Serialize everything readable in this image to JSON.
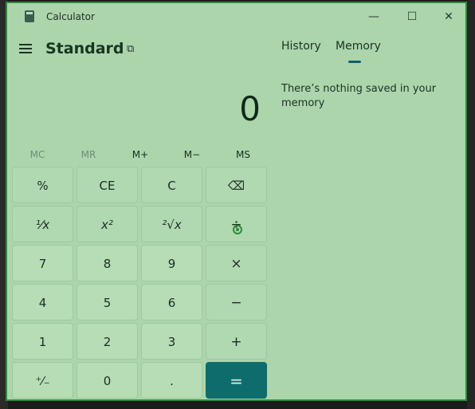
{
  "window": {
    "title": "Calculator",
    "controls": {
      "minimize": "—",
      "maximize": "☐",
      "close": "✕"
    }
  },
  "header": {
    "mode": "Standard"
  },
  "display": {
    "value": "0"
  },
  "memory_buttons": [
    {
      "label": "MC",
      "enabled": false
    },
    {
      "label": "MR",
      "enabled": false
    },
    {
      "label": "M+",
      "enabled": true
    },
    {
      "label": "M−",
      "enabled": true
    },
    {
      "label": "MS",
      "enabled": true
    }
  ],
  "keys": {
    "percent": "%",
    "ce": "CE",
    "c": "C",
    "backspace": "⌫",
    "reciprocal": "⅟x",
    "square": "x²",
    "sqrt": "²√x",
    "divide": "÷",
    "seven": "7",
    "eight": "8",
    "nine": "9",
    "multiply": "×",
    "four": "4",
    "five": "5",
    "six": "6",
    "subtract": "−",
    "one": "1",
    "two": "2",
    "three": "3",
    "add": "+",
    "negate": "⁺⁄₋",
    "zero": "0",
    "decimal": ".",
    "equals": "="
  },
  "side_panel": {
    "tabs": [
      "History",
      "Memory"
    ],
    "active_tab": "Memory",
    "empty_message": "There’s nothing saved in your memory"
  },
  "colors": {
    "window_bg": "#acd5ac",
    "key_bg": "#b6ddb6",
    "equals_bg": "#0e6d6c",
    "accent_underline": "#0f5f6b",
    "border": "#2f8a3a"
  }
}
